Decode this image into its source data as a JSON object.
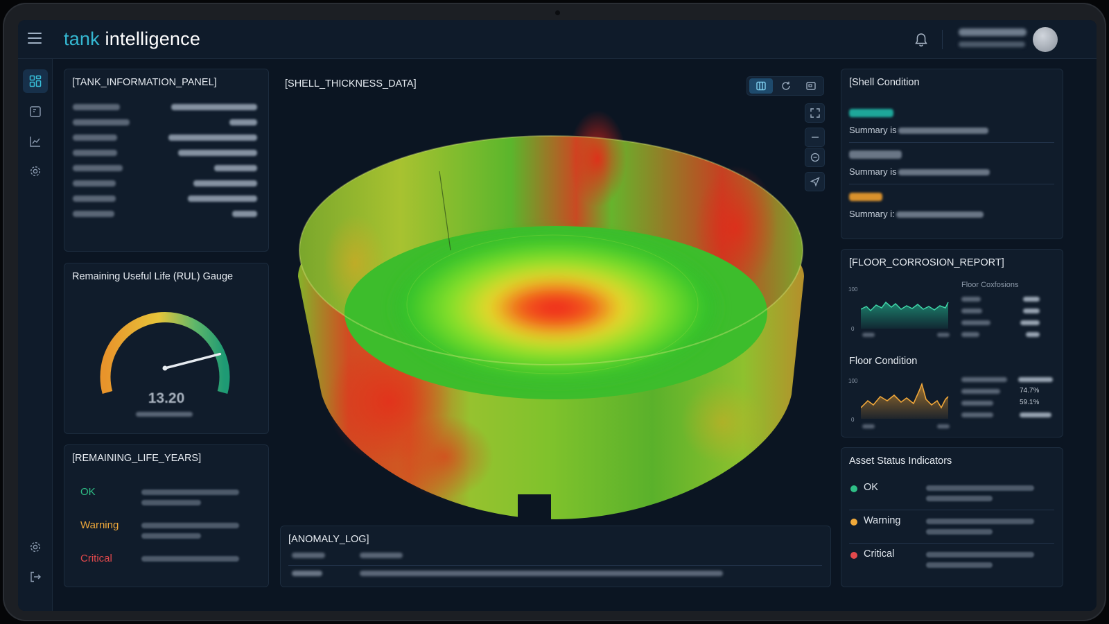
{
  "app": {
    "brand_a": "tank",
    "brand_b": "intelligence"
  },
  "nav": {
    "items": [
      {
        "name": "dashboard-icon",
        "active": true
      },
      {
        "name": "report-icon",
        "active": false
      },
      {
        "name": "trend-chart-icon",
        "active": false
      },
      {
        "name": "settings-icon",
        "active": false
      }
    ],
    "bottom": [
      {
        "name": "settings-icon"
      },
      {
        "name": "logout-icon"
      }
    ]
  },
  "panels": {
    "tank_info": {
      "title": "[TANK_INFORMATION_PANEL]"
    },
    "rul": {
      "title": "Remaining Useful Life (RUL) Gauge",
      "value": "13.20",
      "level_fraction": 0.78
    },
    "remaining_life": {
      "title": "[REMAINING_LIFE_YEARS]",
      "items": [
        {
          "label": "OK",
          "color": "#2fbe86"
        },
        {
          "label": "Warning",
          "color": "#f0a93a"
        },
        {
          "label": "Critical",
          "color": "#e2494c"
        }
      ]
    },
    "shell": {
      "title": "[SHELL_THICKNESS_DATA]"
    },
    "anomaly": {
      "title": "[ANOMALY_LOG]"
    },
    "shell_condition": {
      "title": "[Shell Condition",
      "sections": [
        {
          "head_color": "#1ea79a",
          "summary": "Summary is"
        },
        {
          "head_color": "#6a7686",
          "summary": "Summary is"
        },
        {
          "head_color": "#d9912c",
          "summary": "Summary i:"
        }
      ]
    },
    "floor_corrosion": {
      "title": "[FLOOR_CORROSION_REPORT]",
      "chart_caption": "Floor Coxfosions",
      "y_top": "100",
      "y_bottom": "0"
    },
    "floor_condition": {
      "title": "Floor Condition",
      "y_top": "100",
      "y_bottom": "0",
      "value_1": "74.7%",
      "value_2": "59.1%"
    },
    "asset_status": {
      "title": "Asset Status Indicators",
      "items": [
        {
          "label": "OK",
          "color": "#2fbe86"
        },
        {
          "label": "Warning",
          "color": "#f0a93a"
        },
        {
          "label": "Critical",
          "color": "#e2494c"
        }
      ]
    }
  },
  "colors": {
    "accent": "#35b8d2",
    "panel_bg": "#101c2b",
    "ok": "#2fbe86",
    "warning": "#f0a93a",
    "critical": "#e2494c"
  }
}
